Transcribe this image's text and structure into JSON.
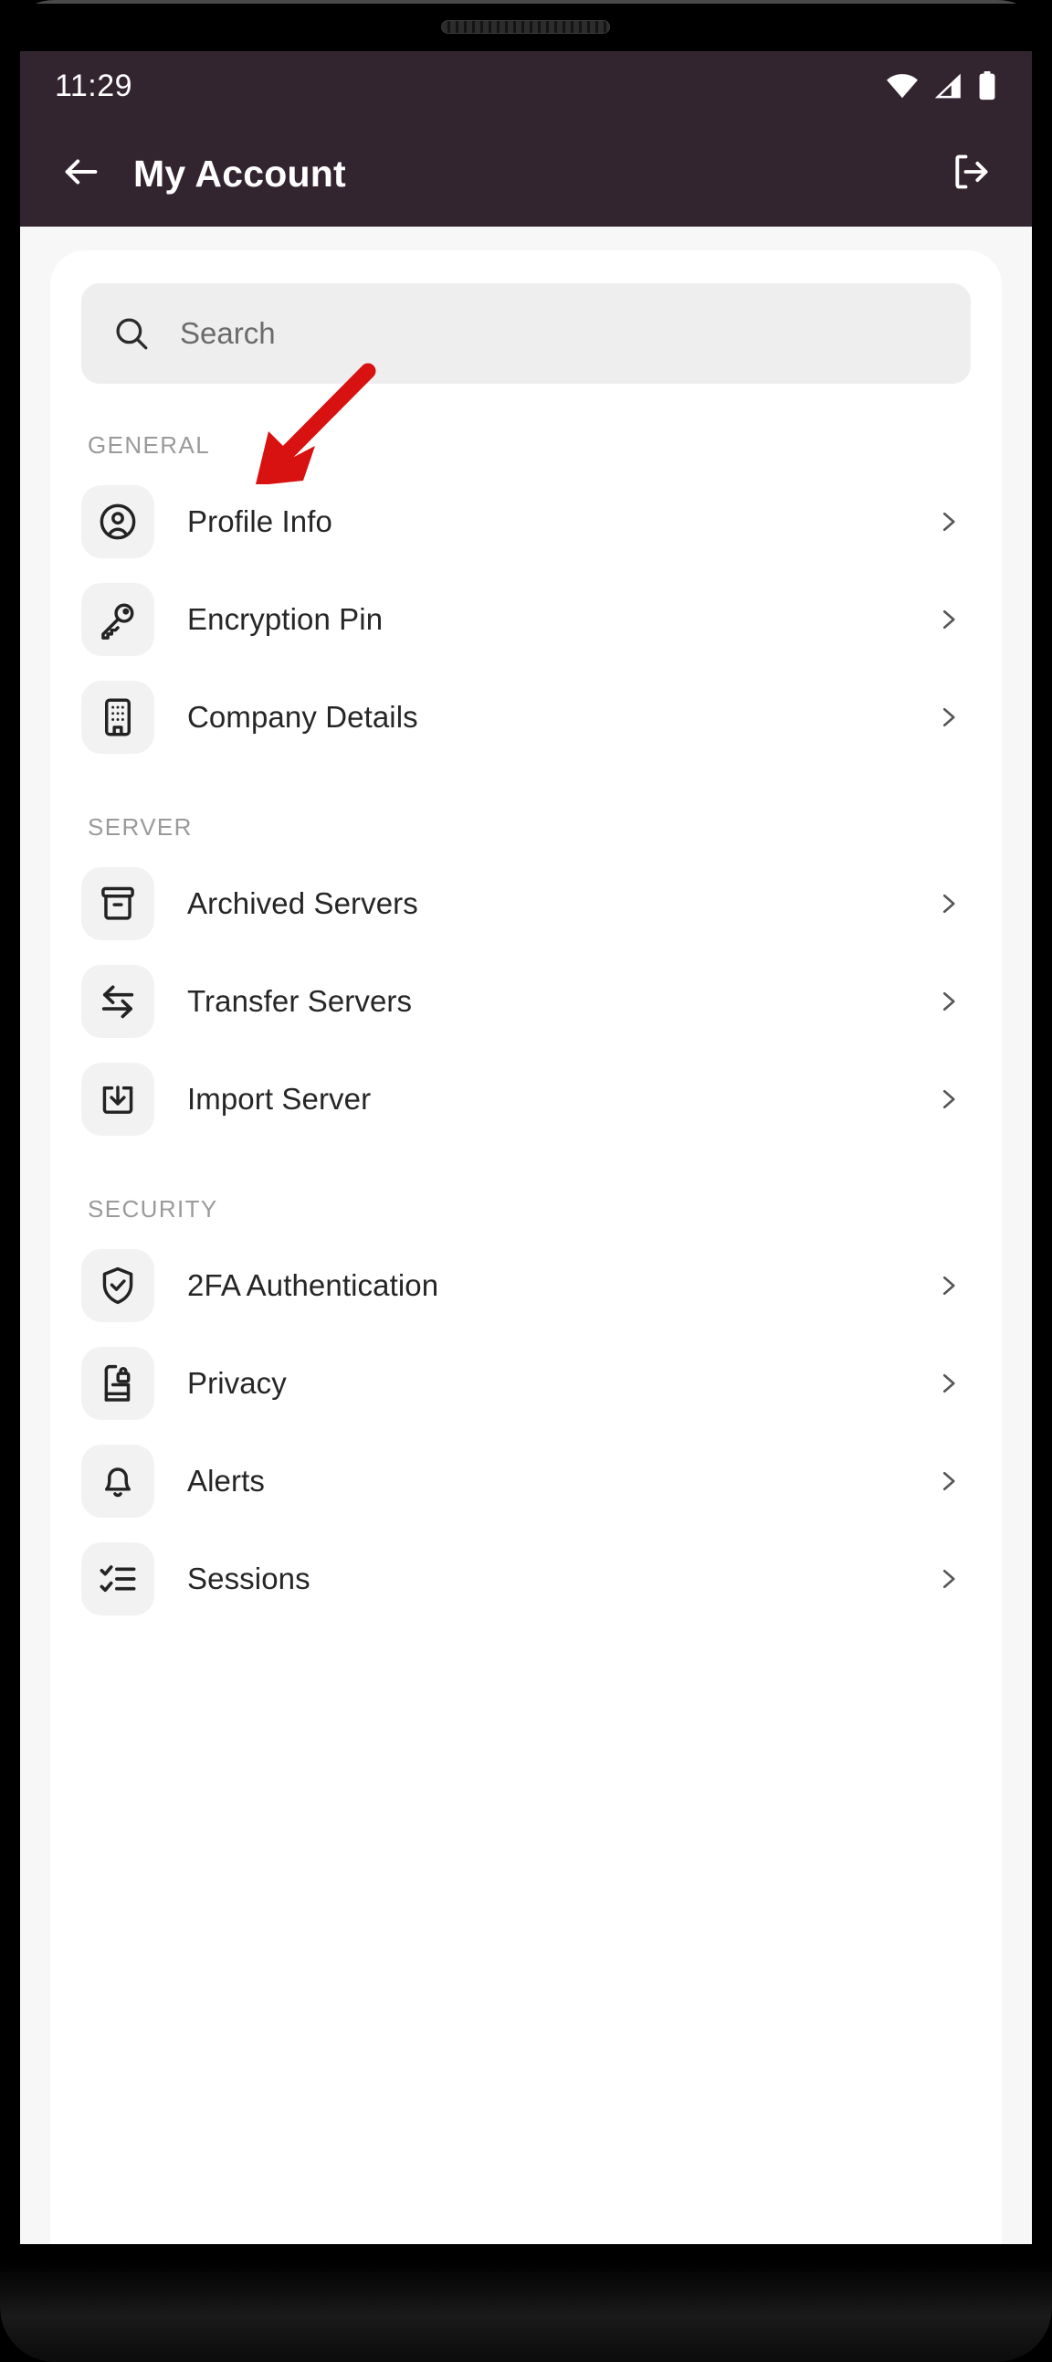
{
  "status_bar": {
    "time": "11:29",
    "icons": [
      "wifi-icon",
      "cellular-signal-icon",
      "battery-icon"
    ]
  },
  "header": {
    "back_icon": "arrow-left-icon",
    "title": "My Account",
    "logout_icon": "logout-icon"
  },
  "search": {
    "icon": "search-icon",
    "placeholder": "Search",
    "value": ""
  },
  "sections": [
    {
      "title": "GENERAL",
      "items": [
        {
          "label": "Profile Info",
          "icon": "user-circle-icon",
          "chevron": "chevron-right-icon"
        },
        {
          "label": "Encryption Pin",
          "icon": "key-icon",
          "chevron": "chevron-right-icon"
        },
        {
          "label": "Company Details",
          "icon": "building-icon",
          "chevron": "chevron-right-icon"
        }
      ]
    },
    {
      "title": "SERVER",
      "items": [
        {
          "label": "Archived Servers",
          "icon": "archive-box-icon",
          "chevron": "chevron-right-icon"
        },
        {
          "label": "Transfer Servers",
          "icon": "transfer-arrows-icon",
          "chevron": "chevron-right-icon"
        },
        {
          "label": "Import Server",
          "icon": "import-download-icon",
          "chevron": "chevron-right-icon"
        }
      ]
    },
    {
      "title": "SECURITY",
      "items": [
        {
          "label": "2FA Authentication",
          "icon": "shield-check-icon",
          "chevron": "chevron-right-icon"
        },
        {
          "label": "Privacy",
          "icon": "book-lock-icon",
          "chevron": "chevron-right-icon"
        },
        {
          "label": "Alerts",
          "icon": "bell-icon",
          "chevron": "chevron-right-icon"
        },
        {
          "label": "Sessions",
          "icon": "checklist-icon",
          "chevron": "chevron-right-icon"
        }
      ]
    }
  ],
  "annotation": {
    "type": "arrow",
    "color": "#d81111",
    "points_to": "Encryption Pin"
  },
  "system_nav": {
    "home_indicator": "home-indicator"
  },
  "colors": {
    "header_bg": "#332530",
    "page_bg": "#f5f5f5",
    "card_bg": "#ffffff",
    "search_bg": "#eeeeee",
    "icon_tile_bg": "#f2f2f2",
    "label_text": "#262626",
    "section_text": "#9a9a9a",
    "annotation_red": "#d81111"
  }
}
